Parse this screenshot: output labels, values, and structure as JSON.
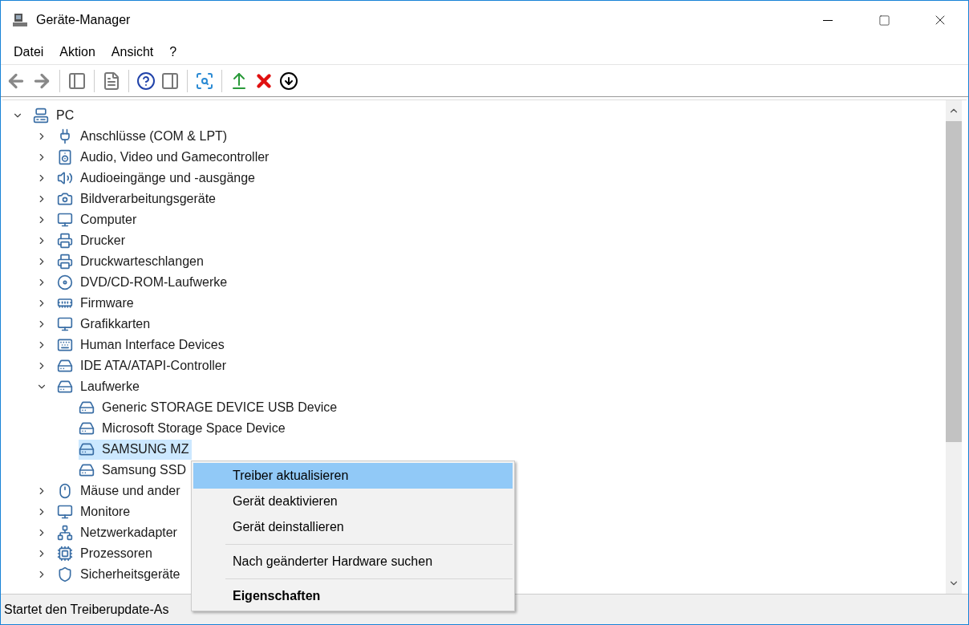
{
  "window": {
    "title": "Geräte-Manager"
  },
  "menu": [
    "Datei",
    "Aktion",
    "Ansicht",
    "?"
  ],
  "tree": {
    "label": "PC",
    "expanded": true,
    "selected": false,
    "children": [
      {
        "label": "Anschlüsse (COM & LPT)",
        "expanded": false,
        "selected": false
      },
      {
        "label": "Audio, Video und Gamecontroller",
        "expanded": false,
        "selected": false
      },
      {
        "label": "Audioeingänge und -ausgänge",
        "expanded": false,
        "selected": false
      },
      {
        "label": "Bildverarbeitungsgeräte",
        "expanded": false,
        "selected": false
      },
      {
        "label": "Computer",
        "expanded": false,
        "selected": false
      },
      {
        "label": "Drucker",
        "expanded": false,
        "selected": false
      },
      {
        "label": "Druckwarteschlangen",
        "expanded": false,
        "selected": false
      },
      {
        "label": "DVD/CD-ROM-Laufwerke",
        "expanded": false,
        "selected": false
      },
      {
        "label": "Firmware",
        "expanded": false,
        "selected": false
      },
      {
        "label": "Grafikkarten",
        "expanded": false,
        "selected": false
      },
      {
        "label": "Human Interface Devices",
        "expanded": false,
        "selected": false
      },
      {
        "label": "IDE ATA/ATAPI-Controller",
        "expanded": false,
        "selected": false
      },
      {
        "label": "Laufwerke",
        "expanded": true,
        "selected": false,
        "children": [
          {
            "label": "Generic STORAGE DEVICE USB Device",
            "selected": false
          },
          {
            "label": "Microsoft Storage Space Device",
            "selected": false
          },
          {
            "label": "SAMSUNG MZ",
            "selected": true
          },
          {
            "label": "Samsung SSD",
            "selected": false
          }
        ]
      },
      {
        "label": "Mäuse und ander",
        "expanded": false,
        "selected": false
      },
      {
        "label": "Monitore",
        "expanded": false,
        "selected": false
      },
      {
        "label": "Netzwerkadapter",
        "expanded": false,
        "selected": false
      },
      {
        "label": "Prozessoren",
        "expanded": false,
        "selected": false
      },
      {
        "label": "Sicherheitsgeräte",
        "expanded": false,
        "selected": false
      }
    ]
  },
  "context_menu": [
    {
      "kind": "item",
      "label": "Treiber aktualisieren",
      "selected": true,
      "default": false
    },
    {
      "kind": "item",
      "label": "Gerät deaktivieren",
      "selected": false,
      "default": false
    },
    {
      "kind": "item",
      "label": "Gerät deinstallieren",
      "selected": false,
      "default": false
    },
    {
      "kind": "separator"
    },
    {
      "kind": "item",
      "label": "Nach geänderter Hardware suchen",
      "selected": false,
      "default": false
    },
    {
      "kind": "separator"
    },
    {
      "kind": "item",
      "label": "Eigenschaften",
      "selected": false,
      "default": true
    }
  ],
  "status_bar": "Startet den Treiberupdate-As"
}
